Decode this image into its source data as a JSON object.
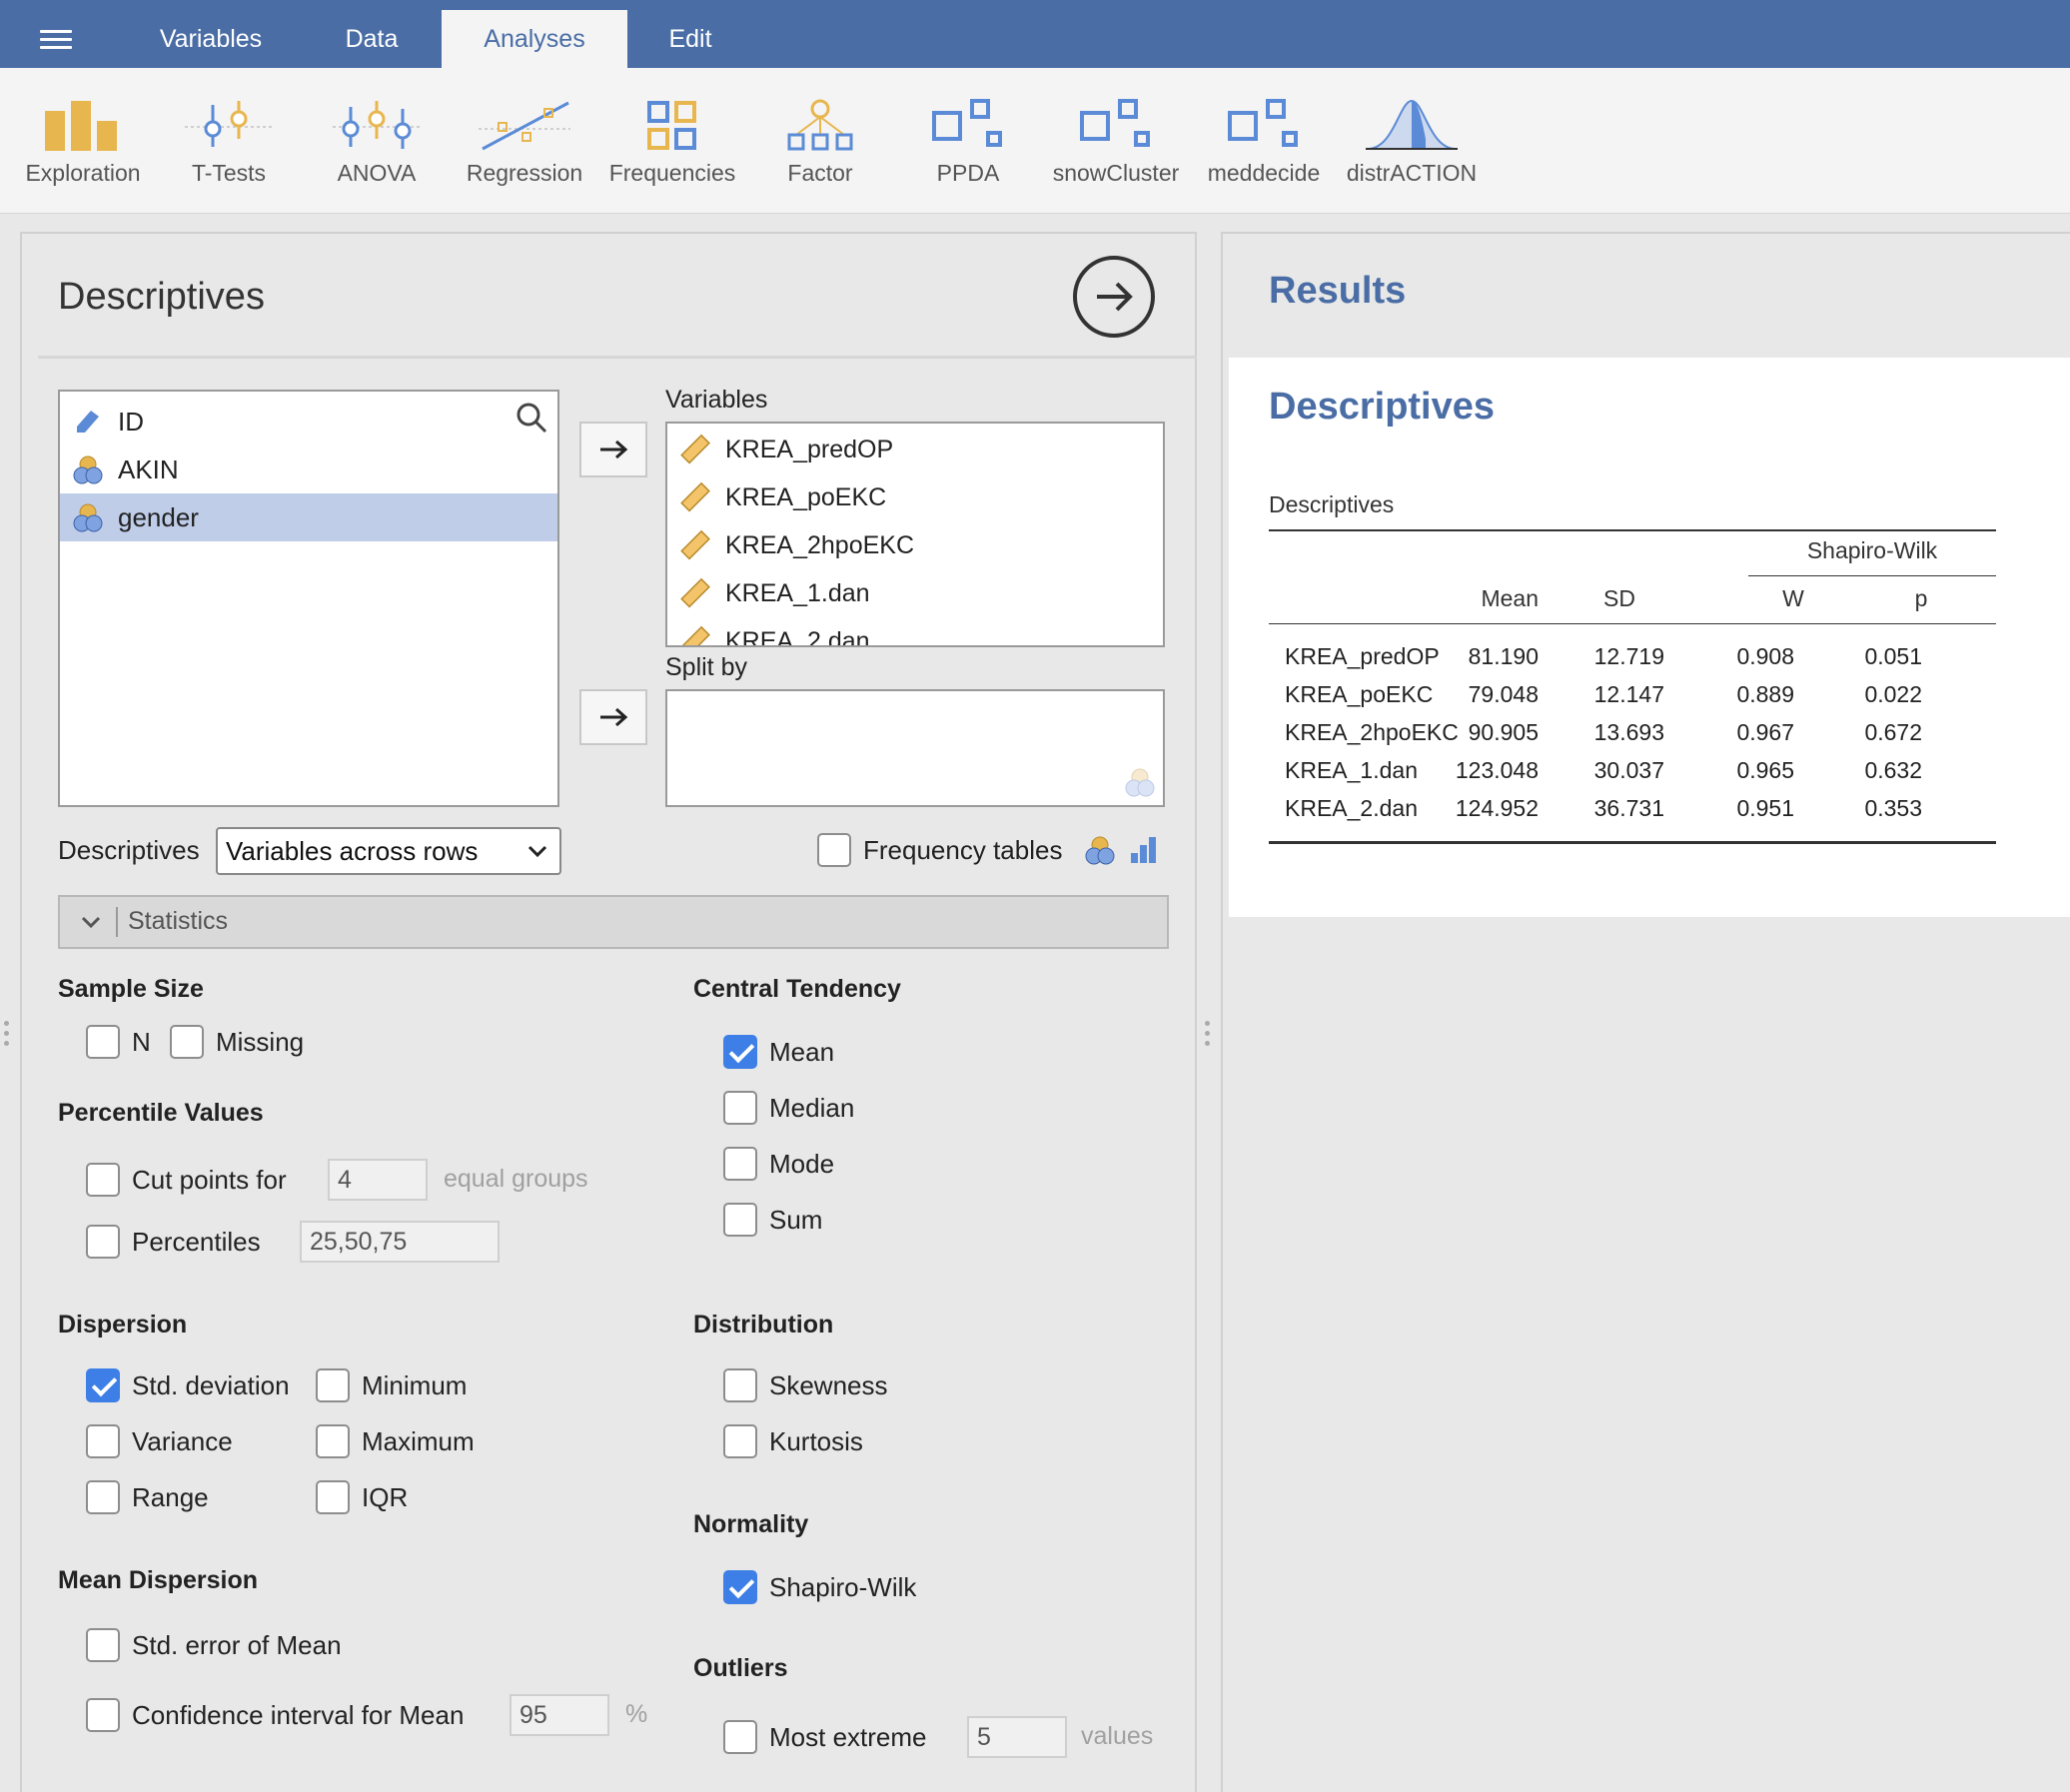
{
  "nav": {
    "tabs": [
      {
        "label": "Variables"
      },
      {
        "label": "Data"
      },
      {
        "label": "Analyses"
      },
      {
        "label": "Edit"
      }
    ],
    "active_tab": "Analyses"
  },
  "ribbon": {
    "items": [
      {
        "label": "Exploration",
        "icon": "exploration-icon"
      },
      {
        "label": "T-Tests",
        "icon": "ttests-icon"
      },
      {
        "label": "ANOVA",
        "icon": "anova-icon"
      },
      {
        "label": "Regression",
        "icon": "regression-icon"
      },
      {
        "label": "Frequencies",
        "icon": "frequencies-icon"
      },
      {
        "label": "Factor",
        "icon": "factor-icon"
      },
      {
        "label": "PPDA",
        "icon": "module-icon"
      },
      {
        "label": "snowCluster",
        "icon": "module-icon"
      },
      {
        "label": "meddecide",
        "icon": "module-icon"
      },
      {
        "label": "distrACTION",
        "icon": "distribution-icon"
      }
    ]
  },
  "options": {
    "title": "Descriptives",
    "available_vars": [
      {
        "name": "ID",
        "type": "id"
      },
      {
        "name": "AKIN",
        "type": "nominal"
      },
      {
        "name": "gender",
        "type": "nominal",
        "selected": true
      }
    ],
    "variables_label": "Variables",
    "variables": [
      "KREA_predOP",
      "KREA_poEKC",
      "KREA_2hpoEKC",
      "KREA_1.dan",
      "KREA_2.dan"
    ],
    "splitby_label": "Split by",
    "descriptives_label": "Descriptives",
    "descriptives_select": "Variables across rows",
    "frequency_tables": {
      "label": "Frequency tables",
      "checked": false
    },
    "statistics_header": "Statistics",
    "sample_size": {
      "title": "Sample Size",
      "n": {
        "label": "N",
        "checked": false
      },
      "missing": {
        "label": "Missing",
        "checked": false
      }
    },
    "percentile": {
      "title": "Percentile Values",
      "cut_points": {
        "label": "Cut points for",
        "value": "4",
        "suffix": "equal groups",
        "checked": false
      },
      "percentiles": {
        "label": "Percentiles",
        "value": "25,50,75",
        "checked": false
      }
    },
    "dispersion": {
      "title": "Dispersion",
      "std": {
        "label": "Std. deviation",
        "checked": true
      },
      "minimum": {
        "label": "Minimum",
        "checked": false
      },
      "variance": {
        "label": "Variance",
        "checked": false
      },
      "maximum": {
        "label": "Maximum",
        "checked": false
      },
      "range": {
        "label": "Range",
        "checked": false
      },
      "iqr": {
        "label": "IQR",
        "checked": false
      }
    },
    "mean_dispersion": {
      "title": "Mean Dispersion",
      "se": {
        "label": "Std. error of Mean",
        "checked": false
      },
      "ci": {
        "label": "Confidence interval for Mean",
        "value": "95",
        "suffix": "%",
        "checked": false
      }
    },
    "central": {
      "title": "Central Tendency",
      "mean": {
        "label": "Mean",
        "checked": true
      },
      "median": {
        "label": "Median",
        "checked": false
      },
      "mode": {
        "label": "Mode",
        "checked": false
      },
      "sum": {
        "label": "Sum",
        "checked": false
      }
    },
    "distribution": {
      "title": "Distribution",
      "skewness": {
        "label": "Skewness",
        "checked": false
      },
      "kurtosis": {
        "label": "Kurtosis",
        "checked": false
      }
    },
    "normality": {
      "title": "Normality",
      "shapiro": {
        "label": "Shapiro-Wilk",
        "checked": true
      }
    },
    "outliers": {
      "title": "Outliers",
      "extreme": {
        "label": "Most extreme",
        "value": "5",
        "suffix": "values",
        "checked": false
      }
    }
  },
  "results": {
    "title": "Results",
    "heading": "Descriptives",
    "table": {
      "title": "Descriptives",
      "group_header": "Shapiro-Wilk",
      "columns": [
        "Mean",
        "SD",
        "W",
        "p"
      ],
      "rows": [
        {
          "name": "KREA_predOP",
          "mean": "81.190",
          "sd": "12.719",
          "w": "0.908",
          "p": "0.051"
        },
        {
          "name": "KREA_poEKC",
          "mean": "79.048",
          "sd": "12.147",
          "w": "0.889",
          "p": "0.022"
        },
        {
          "name": "KREA_2hpoEKC",
          "mean": "90.905",
          "sd": "13.693",
          "w": "0.967",
          "p": "0.672"
        },
        {
          "name": "KREA_1.dan",
          "mean": "123.048",
          "sd": "30.037",
          "w": "0.965",
          "p": "0.632"
        },
        {
          "name": "KREA_2.dan",
          "mean": "124.952",
          "sd": "36.731",
          "w": "0.951",
          "p": "0.353"
        }
      ]
    }
  }
}
